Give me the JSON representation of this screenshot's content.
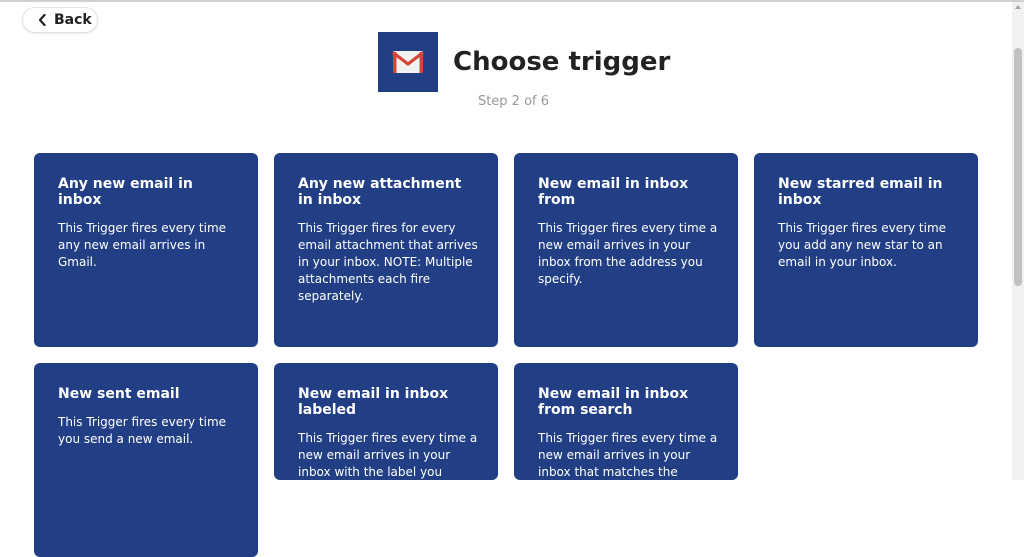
{
  "nav": {
    "back_label": "Back"
  },
  "header": {
    "title": "Choose trigger",
    "step": "Step 2 of 6",
    "logo_icon": "gmail-icon"
  },
  "colors": {
    "card_bg": "#223f86",
    "gmail_red": "#d44638"
  },
  "triggers": [
    {
      "title": "Any new email in inbox",
      "description": "This Trigger fires every time any new email arrives in Gmail."
    },
    {
      "title": "Any new attachment in inbox",
      "description": "This Trigger fires for every email attachment that arrives in your inbox. NOTE: Multiple attachments each fire separately."
    },
    {
      "title": "New email in inbox from",
      "description": "This Trigger fires every time a new email arrives in your inbox from the address you specify."
    },
    {
      "title": "New starred email in inbox",
      "description": "This Trigger fires every time you add any new star to an email in your inbox."
    },
    {
      "title": "New sent email",
      "description": "This Trigger fires every time you send a new email."
    },
    {
      "title": "New email in inbox labeled",
      "description": "This Trigger fires every time a new email arrives in your inbox with the label you"
    },
    {
      "title": "New email in inbox from search",
      "description": "This Trigger fires every time a new email arrives in your inbox that matches the"
    }
  ]
}
